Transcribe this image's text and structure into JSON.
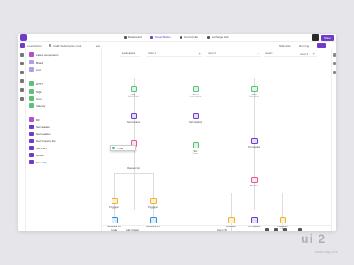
{
  "topbar": {
    "tabs": [
      {
        "label": "Dashboard"
      },
      {
        "label": "Visual Builder"
      },
      {
        "label": "Control Hub"
      },
      {
        "label": "Exchange Hub"
      }
    ],
    "project": "Lead Tracker",
    "share_label": "Share"
  },
  "subbar": {
    "crumb1": "Lead Nurtur",
    "crumb2": "Call it Subscription node",
    "filter": "test",
    "status": "NOE Alive",
    "running": "Running"
  },
  "sidebar": {
    "items": [
      {
        "label": "Latest components",
        "color": "#b04fd0"
      },
      {
        "label": "Brand",
        "color": "#b0a0e8"
      },
      {
        "label": "List",
        "color": "#b0a0e8"
      },
      {
        "label": "HTTP",
        "color": "#5cc07a"
      },
      {
        "label": "SQL",
        "color": "#5cc07a"
      },
      {
        "label": "Cron",
        "color": "#5cc07a"
      },
      {
        "label": "Velocity",
        "color": "#5cc07a"
      },
      {
        "label": "DF",
        "color": "#b04fd0"
      },
      {
        "label": "Set headers",
        "color": "#6e3cc8"
      },
      {
        "label": "Get headers",
        "color": "#6e3cc8"
      },
      {
        "label": "Get Property list",
        "color": "#6e3cc8"
      },
      {
        "label": "Set entry",
        "color": "#6e3cc8"
      },
      {
        "label": "Router",
        "color": "#6e3cc8"
      },
      {
        "label": "Set entry",
        "color": "#6e3cc8"
      }
    ]
  },
  "columns": [
    {
      "label": "Lorem ipsum"
    },
    {
      "label": "router 1"
    },
    {
      "label": "router 2"
    },
    {
      "label": "router 3"
    },
    {
      "label": "router 4"
    }
  ],
  "nodes": {
    "sql": {
      "label": "SQL",
      "sub": "Read request"
    },
    "timer": {
      "label": "Timer",
      "sub": "Cron schedule"
    },
    "get": {
      "label": "GET",
      "sub": "Read params"
    },
    "set_headers": {
      "label": "Set headers"
    },
    "set_headers2": {
      "label": "Set headers"
    },
    "sql2": {
      "label": "SQL",
      "sub": "Update"
    },
    "filter": {
      "label": "Filter"
    },
    "request_list": {
      "label": "Request list"
    },
    "router": {
      "label": "Router"
    },
    "dropdown_timer": {
      "label": "Timer"
    },
    "processor1": {
      "label": "Processor",
      "sub": "Items"
    },
    "processor2": {
      "label": "Processor",
      "sub": "Items"
    },
    "processor3": {
      "label": "Processor",
      "sub": "Items"
    },
    "processor4": {
      "label": "Processor",
      "sub": "Items"
    },
    "set_headers3": {
      "label": "Set headers",
      "sub": "Items"
    },
    "sub_api1": {
      "label": "Substitute API"
    },
    "sub_api2": {
      "label": "Substitute API"
    }
  },
  "bottombar": {
    "code": "Code",
    "add": "Add Instant",
    "zoom": "Zoom 50"
  },
  "brand": {
    "big": "ui 2",
    "small": "www.uibq.com"
  },
  "colors": {
    "accent": "#6e3cc8",
    "green": "#5cc07a",
    "orange": "#f0b030",
    "pink": "#e05a9a"
  }
}
